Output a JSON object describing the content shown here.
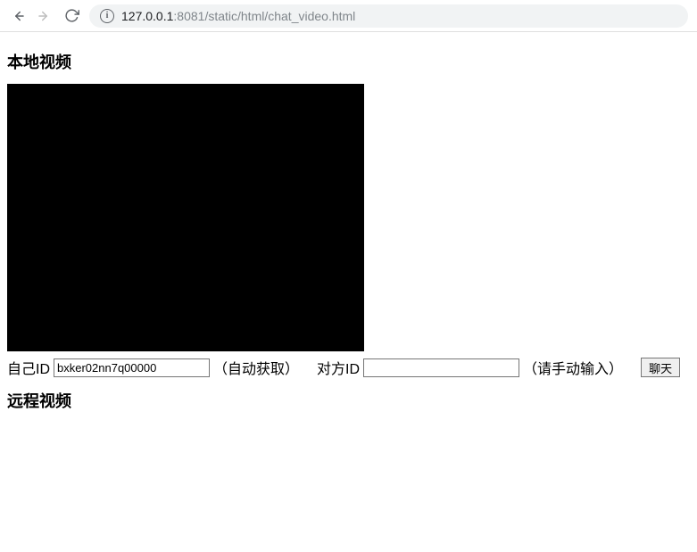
{
  "browser": {
    "url_host": "127.0.0.1",
    "url_port": ":8081",
    "url_path": "/static/html/chat_video.html"
  },
  "headings": {
    "local_video": "本地视频",
    "remote_video": "远程视频"
  },
  "labels": {
    "self_id": "自己ID",
    "self_id_hint": "（自动获取）",
    "other_id": "对方ID",
    "other_id_hint": "（请手动输入）",
    "chat_button": "聊天"
  },
  "values": {
    "self_id": "bxker02nn7q00000",
    "other_id": ""
  }
}
